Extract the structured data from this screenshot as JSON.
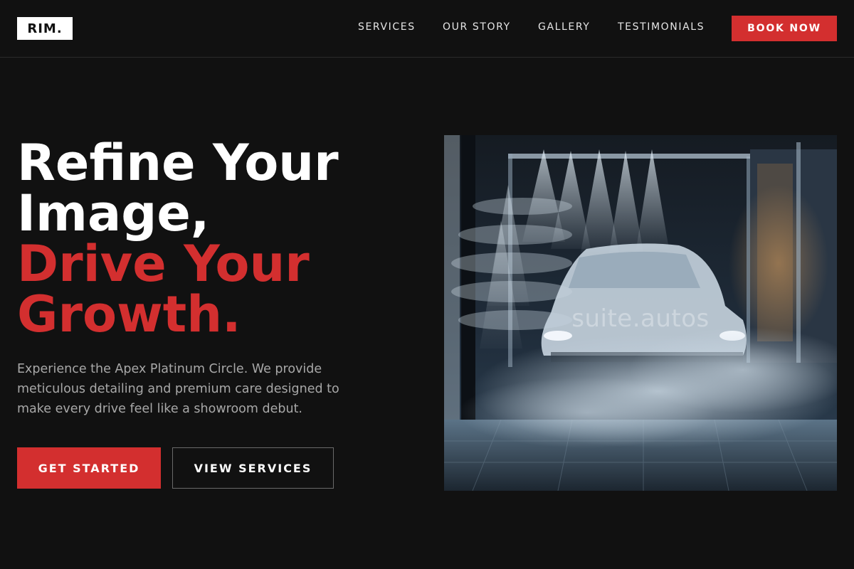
{
  "brand": {
    "logo_text": "RIM."
  },
  "nav": {
    "links": [
      "SERVICES",
      "OUR STORY",
      "GALLERY",
      "TESTIMONIALS"
    ],
    "cta_label": "BOOK NOW"
  },
  "hero": {
    "title_line1": "Refine Your",
    "title_line2": "Image,",
    "title_accent_line1": "Drive Your",
    "title_accent_line2": "Growth.",
    "description": "Experience the Apex Platinum Circle. We provide meticulous detailing and premium care designed to make every drive feel like a showroom debut.",
    "primary_button": "GET STARTED",
    "secondary_button": "VIEW SERVICES",
    "image_watermark": "suite.autos"
  },
  "colors": {
    "background": "#111111",
    "accent": "#d32f2f",
    "text_primary": "#ffffff",
    "text_muted": "#a8a8a8"
  }
}
